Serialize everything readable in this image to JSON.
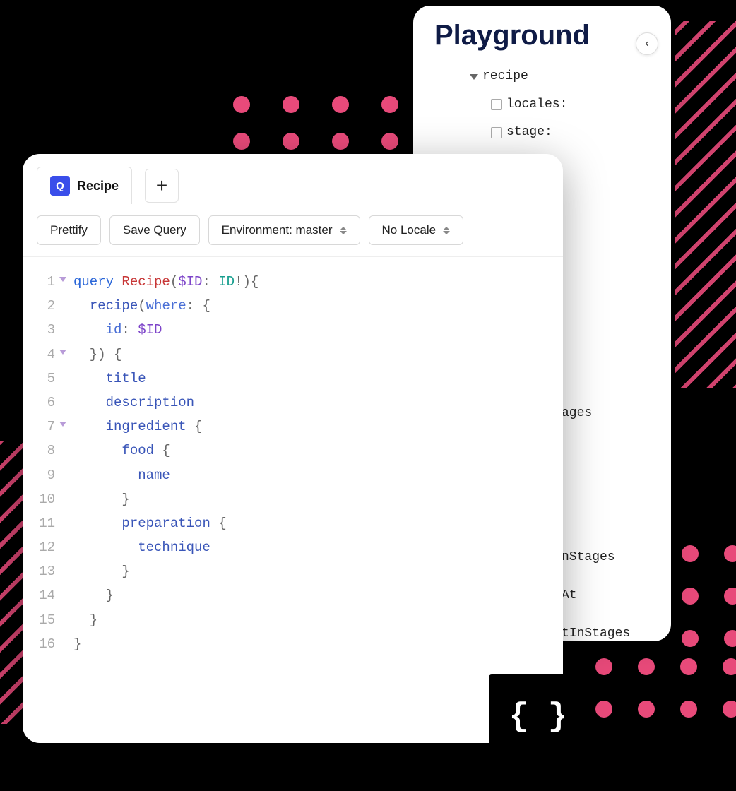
{
  "playground": {
    "title": "Playground",
    "tree": {
      "root": "recipe",
      "children": [
        {
          "label": "locales:"
        },
        {
          "label": "stage:"
        }
      ],
      "extras": [
        "ages",
        "nStages",
        "At",
        "tInStages"
      ]
    }
  },
  "editor": {
    "tab": {
      "badge": "Q",
      "label": "Recipe"
    },
    "toolbar": {
      "prettify": "Prettify",
      "save": "Save Query",
      "environment": "Environment: master",
      "locale": "No Locale"
    },
    "code": {
      "lines": [
        {
          "n": 1,
          "fold": true,
          "tokens": [
            {
              "t": "query ",
              "c": "kw-def"
            },
            {
              "t": "Recipe",
              "c": "kw-name"
            },
            {
              "t": "(",
              "c": "punct"
            },
            {
              "t": "$ID",
              "c": "kw-var"
            },
            {
              "t": ": ",
              "c": "punct"
            },
            {
              "t": "ID",
              "c": "kw-type"
            },
            {
              "t": "!",
              "c": "punct"
            },
            {
              "t": "){",
              "c": "punct"
            }
          ]
        },
        {
          "n": 2,
          "fold": false,
          "tokens": [
            {
              "t": "  ",
              "c": ""
            },
            {
              "t": "recipe",
              "c": "kw-attr"
            },
            {
              "t": "(",
              "c": "punct"
            },
            {
              "t": "where",
              "c": "kw-attr2"
            },
            {
              "t": ": {",
              "c": "punct"
            }
          ]
        },
        {
          "n": 3,
          "fold": false,
          "tokens": [
            {
              "t": "    ",
              "c": ""
            },
            {
              "t": "id",
              "c": "kw-attr2"
            },
            {
              "t": ": ",
              "c": "punct"
            },
            {
              "t": "$ID",
              "c": "kw-var"
            }
          ]
        },
        {
          "n": 4,
          "fold": true,
          "tokens": [
            {
              "t": "  }) {",
              "c": "punct"
            }
          ]
        },
        {
          "n": 5,
          "fold": false,
          "tokens": [
            {
              "t": "    ",
              "c": ""
            },
            {
              "t": "title",
              "c": "kw-attr"
            }
          ]
        },
        {
          "n": 6,
          "fold": false,
          "tokens": [
            {
              "t": "    ",
              "c": ""
            },
            {
              "t": "description",
              "c": "kw-attr"
            }
          ]
        },
        {
          "n": 7,
          "fold": true,
          "tokens": [
            {
              "t": "    ",
              "c": ""
            },
            {
              "t": "ingredient",
              "c": "kw-attr"
            },
            {
              "t": " {",
              "c": "punct"
            }
          ]
        },
        {
          "n": 8,
          "fold": false,
          "tokens": [
            {
              "t": "      ",
              "c": ""
            },
            {
              "t": "food",
              "c": "kw-attr"
            },
            {
              "t": " {",
              "c": "punct"
            }
          ]
        },
        {
          "n": 9,
          "fold": false,
          "tokens": [
            {
              "t": "        ",
              "c": ""
            },
            {
              "t": "name",
              "c": "kw-attr"
            }
          ]
        },
        {
          "n": 10,
          "fold": false,
          "tokens": [
            {
              "t": "      }",
              "c": "punct"
            }
          ]
        },
        {
          "n": 11,
          "fold": false,
          "tokens": [
            {
              "t": "      ",
              "c": ""
            },
            {
              "t": "preparation",
              "c": "kw-attr"
            },
            {
              "t": " {",
              "c": "punct"
            }
          ]
        },
        {
          "n": 12,
          "fold": false,
          "tokens": [
            {
              "t": "        ",
              "c": ""
            },
            {
              "t": "technique",
              "c": "kw-attr"
            }
          ]
        },
        {
          "n": 13,
          "fold": false,
          "tokens": [
            {
              "t": "      }",
              "c": "punct"
            }
          ]
        },
        {
          "n": 14,
          "fold": false,
          "tokens": [
            {
              "t": "    }",
              "c": "punct"
            }
          ]
        },
        {
          "n": 15,
          "fold": false,
          "tokens": [
            {
              "t": "  }",
              "c": "punct"
            }
          ]
        },
        {
          "n": 16,
          "fold": false,
          "tokens": [
            {
              "t": "}",
              "c": "punct"
            }
          ]
        }
      ]
    }
  },
  "blackbox": {
    "glyph": "{ }"
  }
}
